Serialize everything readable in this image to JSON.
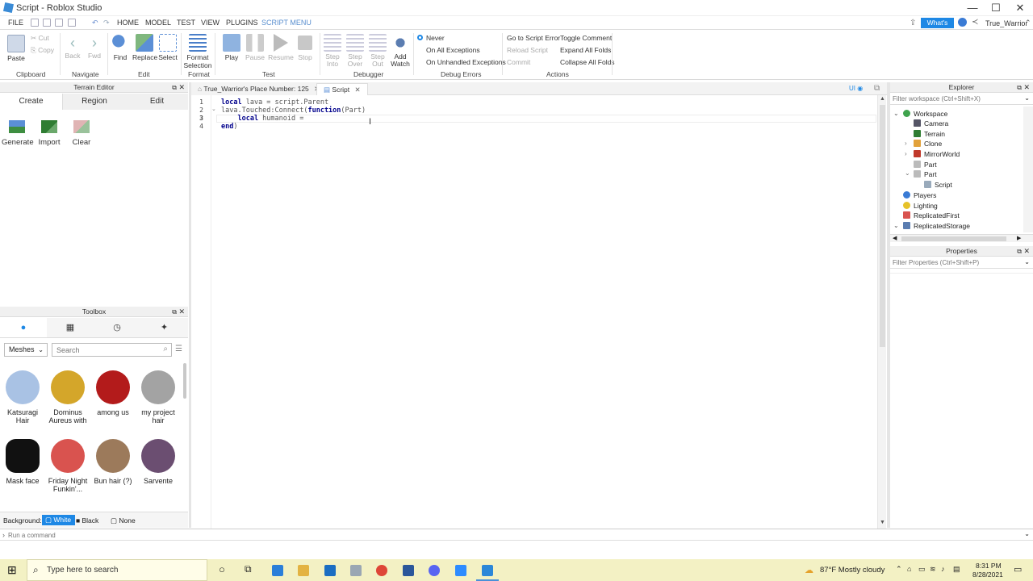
{
  "window": {
    "title": "Script - Roblox Studio",
    "minimize": "—",
    "maximize": "☐",
    "close": "✕"
  },
  "menu": {
    "items": [
      "FILE",
      "HOME",
      "MODEL",
      "TEST",
      "VIEW",
      "PLUGINS",
      "SCRIPT MENU"
    ],
    "whats_new": "What's New",
    "user": "True_Warrior"
  },
  "ribbon": {
    "clipboard": {
      "paste": "Paste",
      "cut": "Cut",
      "copy": "Copy",
      "group": "Clipboard"
    },
    "navigate": {
      "back": "Back",
      "fwd": "Fwd",
      "group": "Navigate"
    },
    "edit": {
      "find": "Find",
      "replace": "Replace",
      "select": "Select",
      "group": "Edit"
    },
    "format": {
      "label": "Format Selection",
      "group": "Format"
    },
    "test": {
      "play": "Play",
      "pause": "Pause",
      "resume": "Resume",
      "stop": "Stop",
      "group": "Test"
    },
    "debugger": {
      "step_into": "Step Into",
      "step_over": "Step Over",
      "step_out": "Step Out",
      "add_watch": "Add Watch",
      "group": "Debugger"
    },
    "debug_errors": {
      "never": "Never",
      "all": "On All Exceptions",
      "unhandled": "On Unhandled Exceptions",
      "group": "Debug Errors"
    },
    "actions": {
      "goto": "Go to Script Error",
      "reload": "Reload Script",
      "commit": "Commit",
      "toggle": "Toggle Comment",
      "expand": "Expand All Folds",
      "collapse": "Collapse All Folds",
      "group": "Actions"
    }
  },
  "terrain_editor": {
    "title": "Terrain Editor",
    "tabs": [
      "Create",
      "Region",
      "Edit"
    ],
    "tools": [
      "Generate",
      "Import",
      "Clear"
    ]
  },
  "toolbox": {
    "title": "Toolbox",
    "category": "Meshes",
    "search_placeholder": "Search",
    "items": [
      "Katsuragi Hair",
      "Dominus Aureus with",
      "among us",
      "my project hair",
      "Mask face",
      "Friday Night Funkin'...",
      "Bun hair (?)",
      "Sarvente"
    ],
    "background_label": "Background:",
    "bg_options": [
      "White",
      "Black",
      "None"
    ]
  },
  "editor": {
    "tabs": [
      "True_Warrior's Place Number: 125",
      "Script"
    ],
    "ui_label": "UI",
    "line_numbers": [
      "1",
      "2",
      "3",
      "4"
    ],
    "lines": [
      [
        {
          "t": "local",
          "c": "#00008b"
        },
        {
          "t": " lava = script.Parent",
          "c": "#333"
        }
      ],
      [
        {
          "t": "lava.Touched:Connect(",
          "c": "#333"
        },
        {
          "t": "function",
          "c": "#00008b"
        },
        {
          "t": "(Part)",
          "c": "#333"
        }
      ],
      [
        {
          "t": "    local",
          "c": "#00008b"
        },
        {
          "t": " humanoid =",
          "c": "#333"
        }
      ],
      [
        {
          "t": "end",
          "c": "#00008b"
        },
        {
          "t": ")",
          "c": "#333"
        }
      ]
    ]
  },
  "explorer": {
    "title": "Explorer",
    "filter_placeholder": "Filter workspace (Ctrl+Shift+X)",
    "tree": [
      {
        "label": "Workspace",
        "color": "#3fa34d"
      },
      {
        "label": "Camera",
        "color": "#556"
      },
      {
        "label": "Terrain",
        "color": "#2f7d32"
      },
      {
        "label": "Clone",
        "color": "#e2a23b"
      },
      {
        "label": "MirrorWorld",
        "color": "#c0392b"
      },
      {
        "label": "Part",
        "color": "#bbb"
      },
      {
        "label": "Part",
        "color": "#bbb"
      },
      {
        "label": "Script",
        "color": "#9ab"
      },
      {
        "label": "Players",
        "color": "#3a7bd5"
      },
      {
        "label": "Lighting",
        "color": "#e6c229"
      },
      {
        "label": "ReplicatedFirst",
        "color": "#d9534f"
      },
      {
        "label": "ReplicatedStorage",
        "color": "#5b7db1"
      }
    ]
  },
  "properties": {
    "title": "Properties",
    "filter_placeholder": "Filter Properties (Ctrl+Shift+P)"
  },
  "command_bar": {
    "placeholder": "Run a command"
  },
  "taskbar": {
    "search_placeholder": "Type here to search",
    "weather": "87°F  Mostly cloudy",
    "time": "8:31 PM",
    "date": "8/28/2021"
  }
}
